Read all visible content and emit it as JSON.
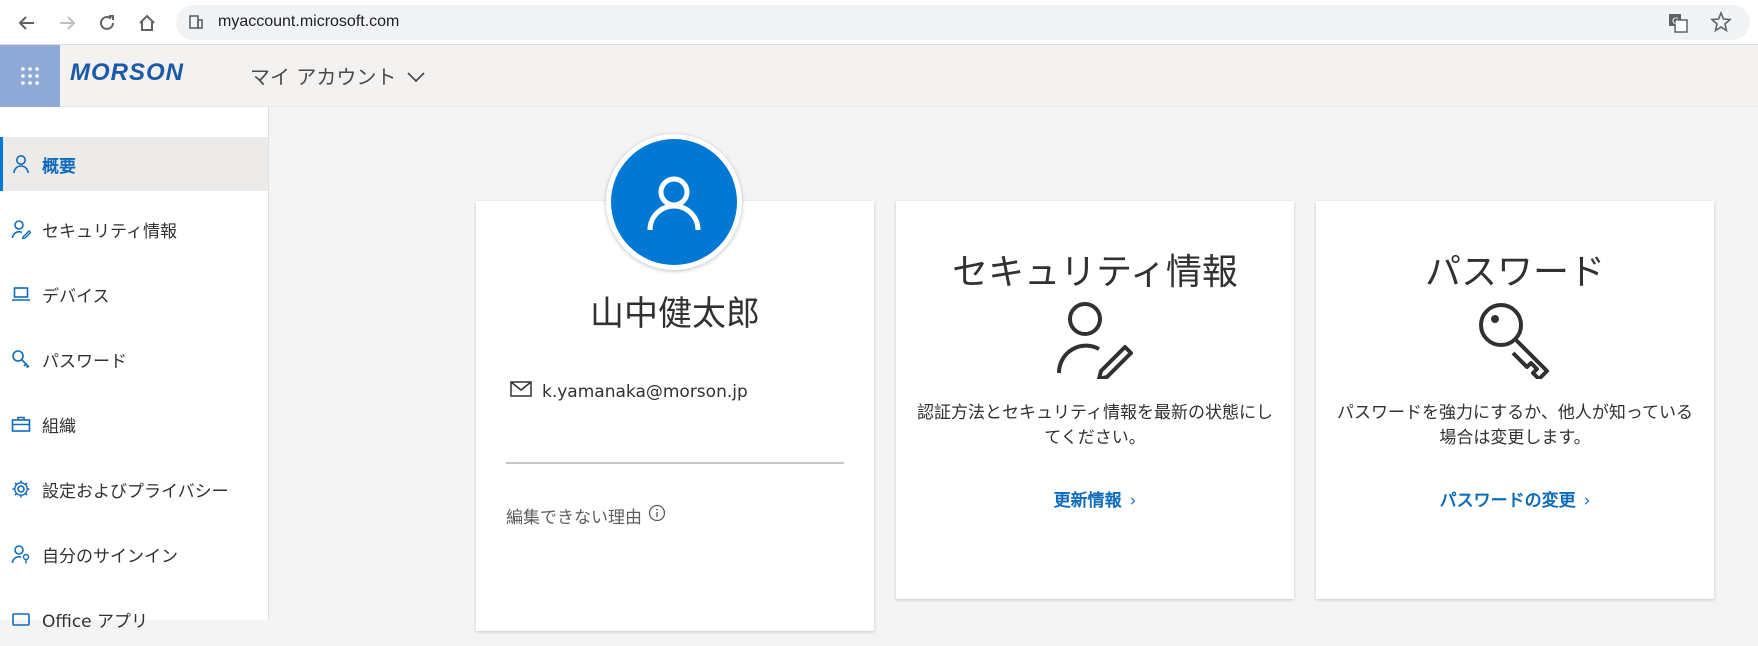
{
  "browser": {
    "url": "myaccount.microsoft.com"
  },
  "header": {
    "brand": "MORSON",
    "app_name": "マイ アカウント"
  },
  "sidebar": {
    "items": [
      {
        "label": "概要",
        "icon": "person-icon",
        "active": true
      },
      {
        "label": "セキュリティ情報",
        "icon": "person-edit-icon"
      },
      {
        "label": "デバイス",
        "icon": "laptop-icon"
      },
      {
        "label": "パスワード",
        "icon": "key-icon"
      },
      {
        "label": "組織",
        "icon": "briefcase-icon"
      },
      {
        "label": "設定およびプライバシー",
        "icon": "gear-icon"
      },
      {
        "label": "自分のサインイン",
        "icon": "person-key-icon"
      },
      {
        "label": "Office アプリ",
        "icon": "office-icon"
      }
    ]
  },
  "profile": {
    "name": "山中健太郎",
    "email": "k.yamanaka@morson.jp",
    "why_cant_edit": "編集できない理由"
  },
  "security_card": {
    "title": "セキュリティ情報",
    "description": "認証方法とセキュリティ情報を最新の状態にしてください。",
    "link": "更新情報"
  },
  "password_card": {
    "title": "パスワード",
    "description": "パスワードを強力にするか、他人が知っている場合は変更します。",
    "link": "パスワードの変更"
  },
  "colors": {
    "accent": "#0078d4",
    "link": "#0f6cbd",
    "waffle_bg": "#8ea9d6"
  }
}
